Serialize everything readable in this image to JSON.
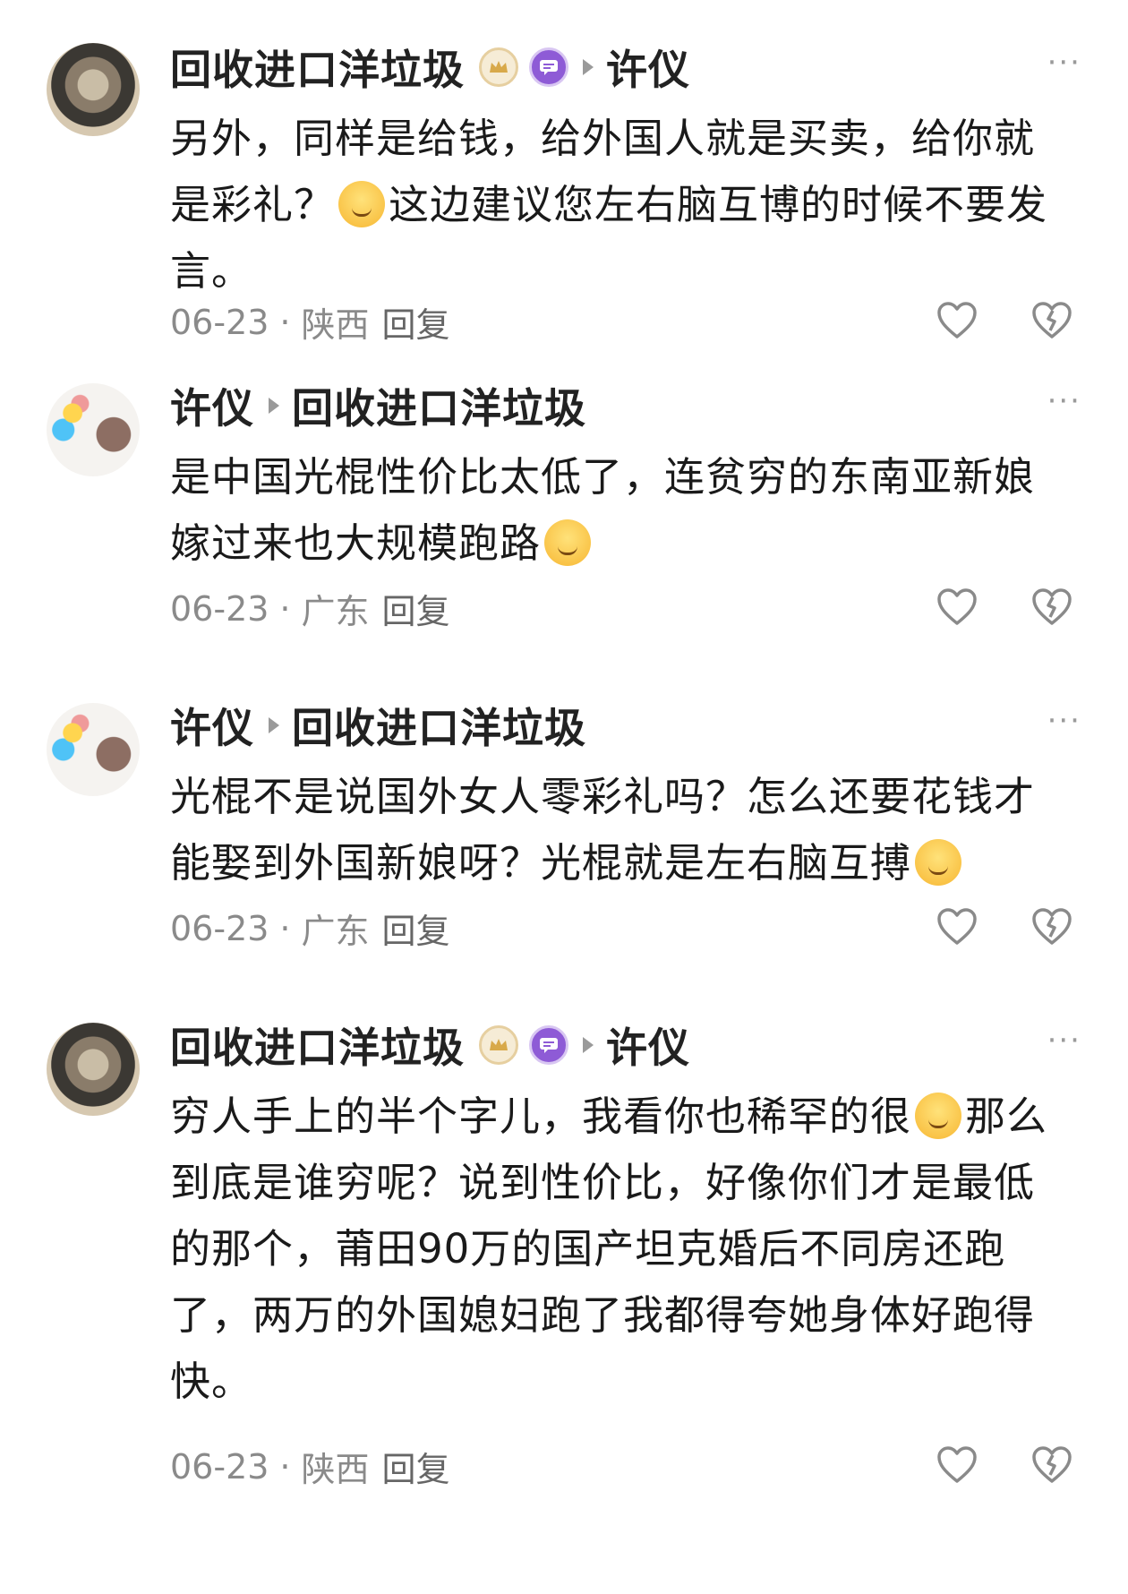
{
  "comments": [
    {
      "author": "回收进口洋垃圾",
      "reply_to": "许仪",
      "text_before": "另外，同样是给钱，给外国人就是买卖，给你就是彩礼？",
      "text_after": "这边建议您左右脑互博的时候不要发言。",
      "date": "06-23",
      "location": "陕西",
      "reply_label": "回复"
    },
    {
      "author": "许仪",
      "reply_to": "回收进口洋垃圾",
      "text_before": "是中国光棍性价比太低了，连贫穷的东南亚新娘嫁过来也大规模跑路",
      "text_after": "",
      "date": "06-23",
      "location": "广东",
      "reply_label": "回复"
    },
    {
      "author": "许仪",
      "reply_to": "回收进口洋垃圾",
      "text_before": "光棍不是说国外女人零彩礼吗？怎么还要花钱才能娶到外国新娘呀？光棍就是左右脑互搏",
      "text_after": "",
      "date": "06-23",
      "location": "广东",
      "reply_label": "回复"
    },
    {
      "author": "回收进口洋垃圾",
      "reply_to": "许仪",
      "text_before": "穷人手上的半个字儿，我看你也稀罕的很",
      "text_after": "那么到底是谁穷呢？说到性价比，好像你们才是最低的那个，莆田90万的国产坦克婚后不同房还跑了，两万的外国媳妇跑了我都得夸她身体好跑得快。",
      "date": "06-23",
      "location": "陕西",
      "reply_label": "回复"
    }
  ],
  "icons": {
    "more": "more-dots-icon",
    "like": "heart-icon",
    "dislike": "broken-heart-icon",
    "crown_badge": "crown-badge-icon",
    "message_badge": "message-badge-icon"
  },
  "colors": {
    "meta_gray": "#8a8a8a",
    "badge_purple": "#8e5bd6",
    "badge_gold": "#e6cfa0"
  }
}
